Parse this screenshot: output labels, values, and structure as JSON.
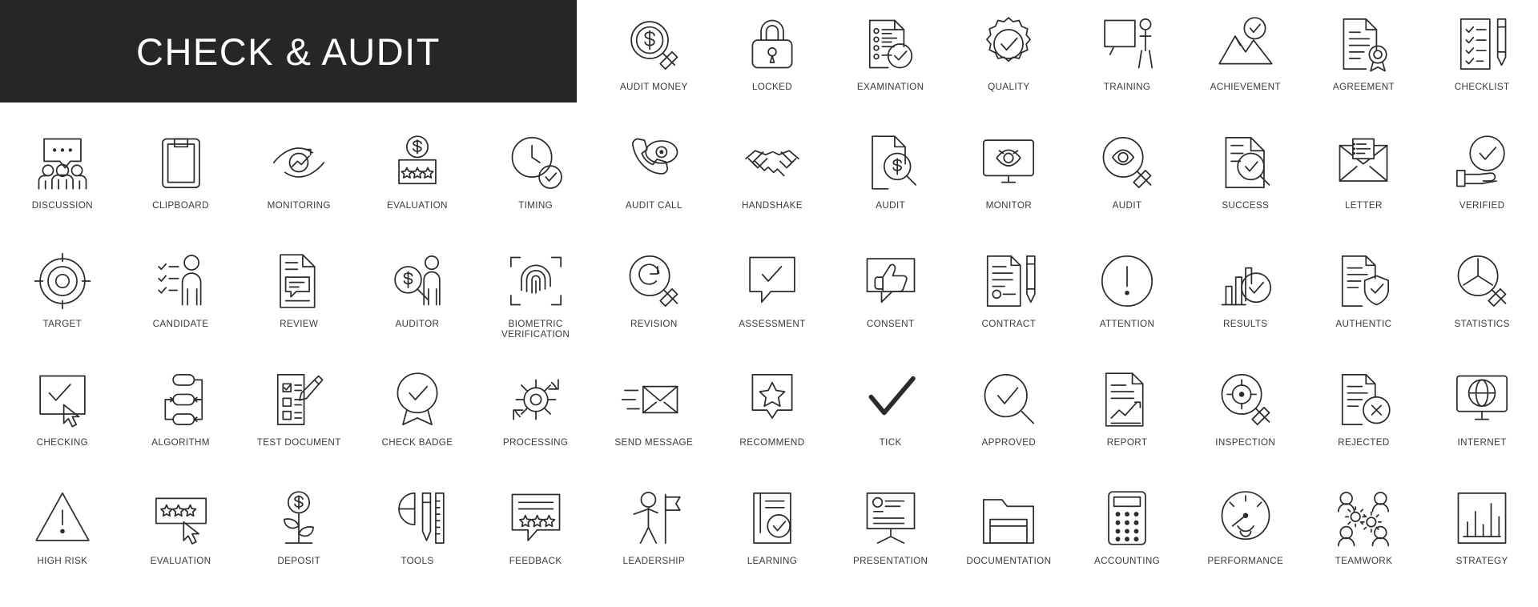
{
  "banner": {
    "title": "CHECK & AUDIT",
    "background": "#262626",
    "text_color": "#ffffff"
  },
  "style": {
    "stroke_color": "#2b2b2b",
    "label_color": "#3a3a3a",
    "page_background": "#ffffff"
  },
  "grid": {
    "columns": 13,
    "rows": 5,
    "total_icons": 65
  },
  "icons": [
    {
      "label": "AUDIT MONEY",
      "icon": "magnifier-dollar-icon",
      "row": 1,
      "col": 6
    },
    {
      "label": "LOCKED",
      "icon": "padlock-icon",
      "row": 1,
      "col": 7
    },
    {
      "label": "EXAMINATION",
      "icon": "checklist-document-check-icon",
      "row": 1,
      "col": 8
    },
    {
      "label": "QUALITY",
      "icon": "badge-rosette-check-icon",
      "row": 1,
      "col": 9
    },
    {
      "label": "TRAINING",
      "icon": "whiteboard-presenter-icon",
      "row": 1,
      "col": 10
    },
    {
      "label": "ACHIEVEMENT",
      "icon": "mountain-peak-check-icon",
      "row": 1,
      "col": 11
    },
    {
      "label": "AGREEMENT",
      "icon": "document-seal-icon",
      "row": 1,
      "col": 12
    },
    {
      "label": "CHECKLIST",
      "icon": "checklist-pencil-icon",
      "row": 1,
      "col": 13
    },
    {
      "label": "DISCUSSION",
      "icon": "people-speech-bubble-icon",
      "row": 2,
      "col": 1
    },
    {
      "label": "CLIPBOARD",
      "icon": "clipboard-icon",
      "row": 2,
      "col": 2
    },
    {
      "label": "MONITORING",
      "icon": "eye-chart-arrow-icon",
      "row": 2,
      "col": 3
    },
    {
      "label": "EVALUATION",
      "icon": "dollar-stars-rating-icon",
      "row": 2,
      "col": 4
    },
    {
      "label": "TIMING",
      "icon": "clock-check-icon",
      "row": 2,
      "col": 5
    },
    {
      "label": "AUDIT CALL",
      "icon": "phone-eye-icon",
      "row": 2,
      "col": 6
    },
    {
      "label": "HANDSHAKE",
      "icon": "handshake-icon",
      "row": 2,
      "col": 7
    },
    {
      "label": "AUDIT",
      "icon": "document-dollar-magnifier-icon",
      "row": 2,
      "col": 8
    },
    {
      "label": "MONITOR",
      "icon": "monitor-eye-icon",
      "row": 2,
      "col": 9
    },
    {
      "label": "AUDIT",
      "icon": "magnifier-eye-icon",
      "row": 2,
      "col": 10
    },
    {
      "label": "SUCCESS",
      "icon": "document-magnifier-check-icon",
      "row": 2,
      "col": 11
    },
    {
      "label": "LETTER",
      "icon": "envelope-document-icon",
      "row": 2,
      "col": 12
    },
    {
      "label": "VERIFIED",
      "icon": "hand-check-circle-icon",
      "row": 2,
      "col": 13
    },
    {
      "label": "TARGET",
      "icon": "target-bullseye-icon",
      "row": 3,
      "col": 1
    },
    {
      "label": "CANDIDATE",
      "icon": "person-checklist-icon",
      "row": 3,
      "col": 2
    },
    {
      "label": "REVIEW",
      "icon": "document-comment-icon",
      "row": 3,
      "col": 3
    },
    {
      "label": "AUDITOR",
      "icon": "person-dollar-magnifier-icon",
      "row": 3,
      "col": 4
    },
    {
      "label": "BIOMETRIC\nVERIFICATION",
      "icon": "fingerprint-scan-icon",
      "row": 3,
      "col": 5
    },
    {
      "label": "REVISION",
      "icon": "magnifier-refresh-icon",
      "row": 3,
      "col": 6
    },
    {
      "label": "ASSESSMENT",
      "icon": "speech-bubble-check-icon",
      "row": 3,
      "col": 7
    },
    {
      "label": "CONSENT",
      "icon": "thumbs-up-bubble-icon",
      "row": 3,
      "col": 8
    },
    {
      "label": "CONTRACT",
      "icon": "document-pencil-icon",
      "row": 3,
      "col": 9
    },
    {
      "label": "ATTENTION",
      "icon": "exclamation-circle-icon",
      "row": 3,
      "col": 10
    },
    {
      "label": "RESULTS",
      "icon": "bar-chart-check-icon",
      "row": 3,
      "col": 11
    },
    {
      "label": "AUTHENTIC",
      "icon": "document-shield-check-icon",
      "row": 3,
      "col": 12
    },
    {
      "label": "STATISTICS",
      "icon": "magnifier-pie-chart-icon",
      "row": 3,
      "col": 13
    },
    {
      "label": "CHECKING",
      "icon": "check-box-cursor-icon",
      "row": 4,
      "col": 1
    },
    {
      "label": "ALGORITHM",
      "icon": "flowchart-arrows-icon",
      "row": 4,
      "col": 2
    },
    {
      "label": "TEST DOCUMENT",
      "icon": "document-checkbox-pencil-icon",
      "row": 4,
      "col": 3
    },
    {
      "label": "CHECK BADGE",
      "icon": "award-ribbon-check-icon",
      "row": 4,
      "col": 4
    },
    {
      "label": "PROCESSING",
      "icon": "gear-refresh-icon",
      "row": 4,
      "col": 5
    },
    {
      "label": "SEND MESSAGE",
      "icon": "envelope-send-icon",
      "row": 4,
      "col": 6
    },
    {
      "label": "RECOMMEND",
      "icon": "star-pin-icon",
      "row": 4,
      "col": 7
    },
    {
      "label": "TICK",
      "icon": "checkmark-icon",
      "row": 4,
      "col": 8
    },
    {
      "label": "APPROVED",
      "icon": "circle-check-magnifier-icon",
      "row": 4,
      "col": 9
    },
    {
      "label": "REPORT",
      "icon": "document-graph-icon",
      "row": 4,
      "col": 10
    },
    {
      "label": "INSPECTION",
      "icon": "magnifier-target-icon",
      "row": 4,
      "col": 11
    },
    {
      "label": "REJECTED",
      "icon": "document-cross-icon",
      "row": 4,
      "col": 12
    },
    {
      "label": "INTERNET",
      "icon": "monitor-globe-icon",
      "row": 4,
      "col": 13
    },
    {
      "label": "HIGH RISK",
      "icon": "warning-triangle-icon",
      "row": 5,
      "col": 1
    },
    {
      "label": "EVALUATION",
      "icon": "star-rating-cursor-icon",
      "row": 5,
      "col": 2
    },
    {
      "label": "DEPOSIT",
      "icon": "dollar-plant-icon",
      "row": 5,
      "col": 3
    },
    {
      "label": "TOOLS",
      "icon": "pencil-ruler-icon",
      "row": 5,
      "col": 4
    },
    {
      "label": "FEEDBACK",
      "icon": "speech-bubble-stars-icon",
      "row": 5,
      "col": 5
    },
    {
      "label": "LEADERSHIP",
      "icon": "person-flag-icon",
      "row": 5,
      "col": 6
    },
    {
      "label": "LEARNING",
      "icon": "book-check-icon",
      "row": 5,
      "col": 7
    },
    {
      "label": "PRESENTATION",
      "icon": "presentation-board-icon",
      "row": 5,
      "col": 8
    },
    {
      "label": "DOCUMENTATION",
      "icon": "folder-icon",
      "row": 5,
      "col": 9
    },
    {
      "label": "ACCOUNTING",
      "icon": "calculator-icon",
      "row": 5,
      "col": 10
    },
    {
      "label": "PERFORMANCE",
      "icon": "speedometer-gauge-icon",
      "row": 5,
      "col": 11
    },
    {
      "label": "TEAMWORK",
      "icon": "team-gears-icon",
      "row": 5,
      "col": 12
    },
    {
      "label": "STRATEGY",
      "icon": "bar-chart-board-icon",
      "row": 5,
      "col": 13
    }
  ]
}
